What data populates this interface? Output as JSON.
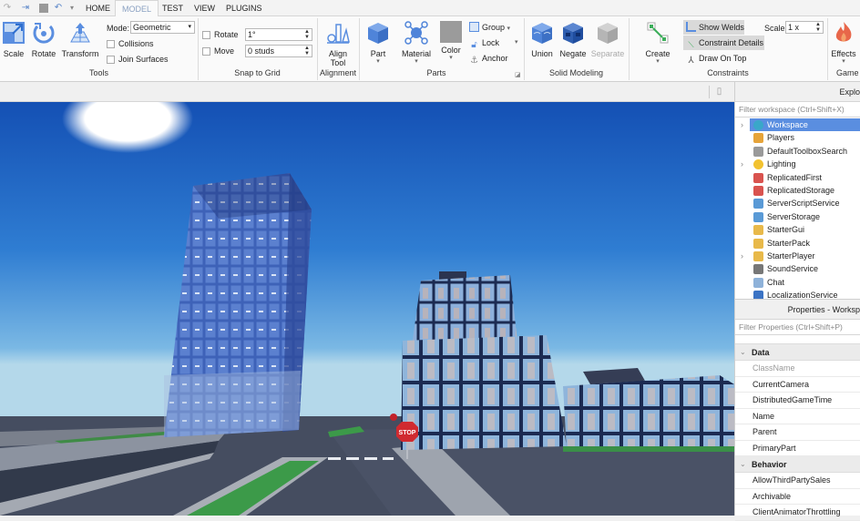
{
  "quick_access": [
    "redo-icon",
    "publish-icon",
    "stop-icon",
    "undo-icon",
    "customize-icon"
  ],
  "tabs": [
    {
      "label": "HOME",
      "active": false
    },
    {
      "label": "MODEL",
      "active": true
    },
    {
      "label": "TEST",
      "active": false
    },
    {
      "label": "VIEW",
      "active": false
    },
    {
      "label": "PLUGINS",
      "active": false
    }
  ],
  "ribbon": {
    "tools": {
      "label": "Tools",
      "scale": "Scale",
      "rotate": "Rotate",
      "transform": "Transform",
      "mode_label": "Mode:",
      "mode_value": "Geometric",
      "collisions": "Collisions",
      "join_surfaces": "Join Surfaces"
    },
    "snap": {
      "label": "Snap to Grid",
      "rotate_label": "Rotate",
      "rotate_value": "1°",
      "move_label": "Move",
      "move_value": "0 studs"
    },
    "alignment": {
      "label": "Alignment",
      "align_tool_line1": "Align",
      "align_tool_line2": "Tool"
    },
    "parts": {
      "label": "Parts",
      "part": "Part",
      "material": "Material",
      "color": "Color",
      "group": "Group",
      "lock": "Lock",
      "anchor": "Anchor"
    },
    "solid_modeling": {
      "label": "Solid Modeling",
      "union": "Union",
      "negate": "Negate",
      "separate": "Separate"
    },
    "constraints": {
      "label": "Constraints",
      "create": "Create",
      "show_welds": "Show Welds",
      "constraint_details": "Constraint Details",
      "draw_on_top": "Draw On Top",
      "scale_label": "Scale",
      "scale_value": "1 x"
    },
    "gameplay": {
      "label": "Game",
      "effects": "Effects"
    }
  },
  "colors": {
    "accent": "#5a8ee0",
    "tab_active_text": "#8aa1c2",
    "sky_top": "#1450b4",
    "sky_bottom": "#a9d3ea"
  },
  "explorer": {
    "title": "Explo",
    "filter_placeholder": "Filter workspace (Ctrl+Shift+X)",
    "items": [
      {
        "label": "Workspace",
        "icon": "globe-icon",
        "expandable": true,
        "selected": true
      },
      {
        "label": "Players",
        "icon": "players-icon",
        "expandable": false
      },
      {
        "label": "DefaultToolboxSearch",
        "icon": "search-model-icon",
        "expandable": false
      },
      {
        "label": "Lighting",
        "icon": "lightbulb-icon",
        "expandable": true
      },
      {
        "label": "ReplicatedFirst",
        "icon": "replicated-first-icon",
        "expandable": false
      },
      {
        "label": "ReplicatedStorage",
        "icon": "replicated-storage-icon",
        "expandable": false
      },
      {
        "label": "ServerScriptService",
        "icon": "server-script-icon",
        "expandable": false
      },
      {
        "label": "ServerStorage",
        "icon": "server-storage-icon",
        "expandable": false
      },
      {
        "label": "StarterGui",
        "icon": "starter-gui-icon",
        "expandable": false
      },
      {
        "label": "StarterPack",
        "icon": "starter-pack-icon",
        "expandable": false
      },
      {
        "label": "StarterPlayer",
        "icon": "starter-player-icon",
        "expandable": true
      },
      {
        "label": "SoundService",
        "icon": "speaker-icon",
        "expandable": false
      },
      {
        "label": "Chat",
        "icon": "chat-icon",
        "expandable": false
      },
      {
        "label": "LocalizationService",
        "icon": "localization-icon",
        "expandable": false
      }
    ]
  },
  "properties": {
    "title": "Properties - Worksp",
    "filter_placeholder": "Filter Properties (Ctrl+Shift+P)",
    "categories": [
      {
        "name": "Data",
        "rows": [
          "ClassName",
          "CurrentCamera",
          "DistributedGameTime",
          "Name",
          "Parent",
          "PrimaryPart"
        ]
      },
      {
        "name": "Behavior",
        "rows": [
          "AllowThirdPartySales",
          "Archivable",
          "ClientAnimatorThrottling"
        ]
      }
    ]
  },
  "viewport": {
    "stop_sign_text": "STOP"
  }
}
